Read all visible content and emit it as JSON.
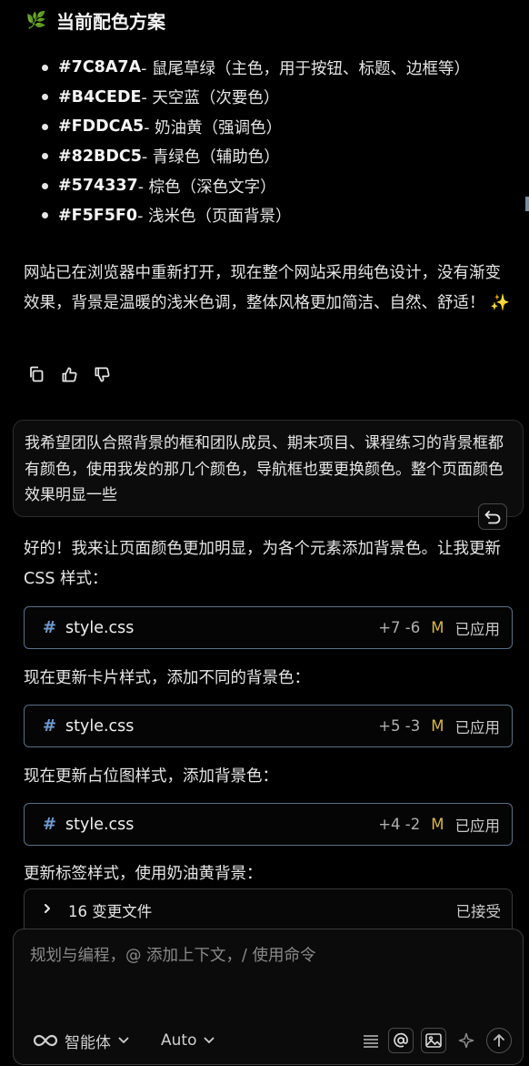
{
  "heading": {
    "icon": "leaf-icon",
    "title": "当前配色方案"
  },
  "colors": [
    {
      "hex": "#7C8A7A",
      "desc": " - 鼠尾草绿（主色，用于按钮、标题、边框等）"
    },
    {
      "hex": "#B4CEDE",
      "desc": " - 天空蓝（次要色）"
    },
    {
      "hex": "#FDDCA5",
      "desc": " - 奶油黄（强调色）"
    },
    {
      "hex": "#82BDC5",
      "desc": " - 青绿色（辅助色）"
    },
    {
      "hex": "#574337",
      "desc": " - 棕色（深色文字）"
    },
    {
      "hex": "#F5F5F0",
      "desc": " - 浅米色（页面背景）"
    }
  ],
  "summary": "网站已在浏览器中重新打开，现在整个网站采用纯色设计，没有渐变效果，背景是温暖的浅米色调，整体风格更加简洁、自然、舒适！ ✨",
  "user_message": "我希望团队合照背景的框和团队成员、期末项目、课程练习的背景框都有颜色，使用我发的那几个颜色，导航框也要更换颜色。整个页面颜色效果明显一些",
  "reply_intro": "好的！我来让页面颜色更加明显，为各个元素添加背景色。让我更新 CSS 样式：",
  "edits": [
    {
      "filename": "style.css",
      "diff": "+7 -6",
      "mod": "M",
      "status": "已应用"
    },
    {
      "filename": "style.css",
      "diff": "+5 -3",
      "mod": "M",
      "status": "已应用"
    },
    {
      "filename": "style.css",
      "diff": "+4 -2",
      "mod": "M",
      "status": "已应用"
    }
  ],
  "steps": [
    "现在更新卡片样式，添加不同的背景色：",
    "现在更新占位图样式，添加背景色：",
    "更新标签样式，使用奶油黄背景："
  ],
  "changes": {
    "label": "16 变更文件",
    "status": "已接受"
  },
  "composer": {
    "placeholder": "规划与编程，@ 添加上下文，/ 使用命令",
    "agent_mode": "智能体",
    "model": "Auto"
  },
  "accent_colors": {
    "modified": "#d6b84a",
    "file_icon": "#6f9bd0",
    "card_border": "#5a6f86"
  }
}
